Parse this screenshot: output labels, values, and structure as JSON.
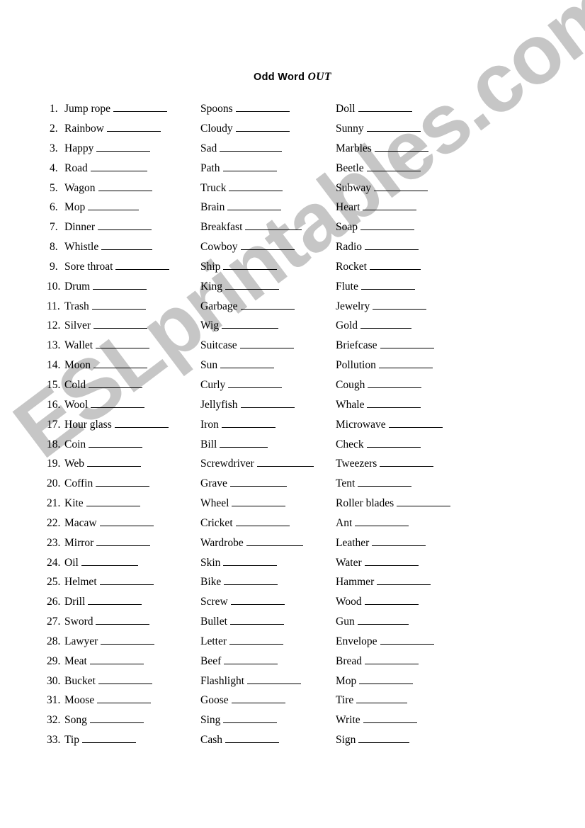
{
  "title": {
    "main": "Odd Word ",
    "emphasis": "OUT"
  },
  "watermark": {
    "text": "ESLprintables.com",
    "color": "#c6c6c6"
  },
  "columns": [
    {
      "name": "column-1",
      "numbered": true,
      "items": [
        {
          "number": "1.",
          "word": "Jump rope",
          "blank_width": 76
        },
        {
          "number": "2.",
          "word": "Rainbow",
          "blank_width": 76
        },
        {
          "number": "3.",
          "word": "Happy",
          "blank_width": 76
        },
        {
          "number": "4.",
          "word": "Road",
          "blank_width": 80
        },
        {
          "number": "5.",
          "word": "Wagon",
          "blank_width": 76
        },
        {
          "number": "6.",
          "word": "Mop",
          "blank_width": 72
        },
        {
          "number": "7.",
          "word": "Dinner",
          "blank_width": 76
        },
        {
          "number": "8.",
          "word": "Whistle",
          "blank_width": 72
        },
        {
          "number": "9.",
          "word": "Sore throat",
          "blank_width": 76
        },
        {
          "number": "10.",
          "word": "Drum",
          "blank_width": 76
        },
        {
          "number": "11.",
          "word": "Trash",
          "blank_width": 76
        },
        {
          "number": "12.",
          "word": "Silver",
          "blank_width": 76
        },
        {
          "number": "13.",
          "word": "Wallet",
          "blank_width": 76
        },
        {
          "number": "14.",
          "word": "Moon",
          "blank_width": 76
        },
        {
          "number": "15.",
          "word": "Cold",
          "blank_width": 76
        },
        {
          "number": "16.",
          "word": "Wool",
          "blank_width": 76
        },
        {
          "number": "17.",
          "word": "Hour glass",
          "blank_width": 76
        },
        {
          "number": "18.",
          "word": "Coin",
          "blank_width": 76
        },
        {
          "number": "19.",
          "word": "Web",
          "blank_width": 76
        },
        {
          "number": "20.",
          "word": "Coffin",
          "blank_width": 76
        },
        {
          "number": "21.",
          "word": "Kite",
          "blank_width": 76
        },
        {
          "number": "22.",
          "word": "Macaw",
          "blank_width": 76
        },
        {
          "number": "23.",
          "word": "Mirror",
          "blank_width": 76
        },
        {
          "number": "24.",
          "word": "Oil",
          "blank_width": 80
        },
        {
          "number": "25.",
          "word": "Helmet",
          "blank_width": 76
        },
        {
          "number": "26.",
          "word": "Drill",
          "blank_width": 76
        },
        {
          "number": "27.",
          "word": "Sword",
          "blank_width": 76
        },
        {
          "number": "28.",
          "word": "Lawyer",
          "blank_width": 76
        },
        {
          "number": "29.",
          "word": "Meat",
          "blank_width": 76
        },
        {
          "number": "30.",
          "word": "Bucket",
          "blank_width": 76
        },
        {
          "number": "31.",
          "word": "Moose",
          "blank_width": 76
        },
        {
          "number": "32.",
          "word": "Song",
          "blank_width": 76
        },
        {
          "number": "33.",
          "word": "Tip",
          "blank_width": 76
        }
      ]
    },
    {
      "name": "column-2",
      "numbered": false,
      "items": [
        {
          "word": "Spoons",
          "blank_width": 76
        },
        {
          "word": "Cloudy",
          "blank_width": 76
        },
        {
          "word": "Sad",
          "blank_width": 88
        },
        {
          "word": "Path",
          "blank_width": 76
        },
        {
          "word": "Truck",
          "blank_width": 76
        },
        {
          "word": "Brain",
          "blank_width": 76
        },
        {
          "word": "Breakfast",
          "blank_width": 80
        },
        {
          "word": "Cowboy",
          "blank_width": 76
        },
        {
          "word": "Ship",
          "blank_width": 76
        },
        {
          "word": "King",
          "blank_width": 76
        },
        {
          "word": "Garbage",
          "blank_width": 76
        },
        {
          "word": "Wig",
          "blank_width": 80
        },
        {
          "word": "Suitcase",
          "blank_width": 76
        },
        {
          "word": "Sun",
          "blank_width": 76
        },
        {
          "word": "Curly",
          "blank_width": 76
        },
        {
          "word": "Jellyfish",
          "blank_width": 76
        },
        {
          "word": "Iron",
          "blank_width": 76
        },
        {
          "word": "Bill",
          "blank_width": 68
        },
        {
          "word": "Screwdriver",
          "blank_width": 80
        },
        {
          "word": "Grave",
          "blank_width": 80
        },
        {
          "word": "Wheel",
          "blank_width": 76
        },
        {
          "word": "Cricket",
          "blank_width": 76
        },
        {
          "word": "Wardrobe",
          "blank_width": 80
        },
        {
          "word": "Skin",
          "blank_width": 76
        },
        {
          "word": "Bike",
          "blank_width": 76
        },
        {
          "word": "Screw",
          "blank_width": 76
        },
        {
          "word": "Bullet",
          "blank_width": 76
        },
        {
          "word": "Letter",
          "blank_width": 76
        },
        {
          "word": "Beef",
          "blank_width": 76
        },
        {
          "word": "Flashlight",
          "blank_width": 76
        },
        {
          "word": "Goose",
          "blank_width": 76
        },
        {
          "word": "Sing",
          "blank_width": 76
        },
        {
          "word": "Cash",
          "blank_width": 76
        }
      ]
    },
    {
      "name": "column-3",
      "numbered": false,
      "items": [
        {
          "word": "Doll",
          "blank_width": 76
        },
        {
          "word": "Sunny",
          "blank_width": 76
        },
        {
          "word": "Marbles",
          "blank_width": 76
        },
        {
          "word": "Beetle",
          "blank_width": 76
        },
        {
          "word": "Subway",
          "blank_width": 76
        },
        {
          "word": "Heart",
          "blank_width": 76
        },
        {
          "word": "Soap",
          "blank_width": 76
        },
        {
          "word": "Radio",
          "blank_width": 76
        },
        {
          "word": "Rocket",
          "blank_width": 72
        },
        {
          "word": "Flute",
          "blank_width": 76
        },
        {
          "word": "Jewelry",
          "blank_width": 76
        },
        {
          "word": "Gold",
          "blank_width": 72
        },
        {
          "word": "Briefcase",
          "blank_width": 76
        },
        {
          "word": "Pollution",
          "blank_width": 76
        },
        {
          "word": "Cough",
          "blank_width": 76
        },
        {
          "word": "Whale",
          "blank_width": 76
        },
        {
          "word": "Microwave",
          "blank_width": 76
        },
        {
          "word": "Check",
          "blank_width": 76
        },
        {
          "word": "Tweezers",
          "blank_width": 76
        },
        {
          "word": "Tent",
          "blank_width": 76
        },
        {
          "word": "Roller blades",
          "blank_width": 76
        },
        {
          "word": "Ant",
          "blank_width": 76
        },
        {
          "word": "Leather",
          "blank_width": 76
        },
        {
          "word": "Water",
          "blank_width": 76
        },
        {
          "word": "Hammer",
          "blank_width": 76
        },
        {
          "word": "Wood",
          "blank_width": 76
        },
        {
          "word": "Gun",
          "blank_width": 72
        },
        {
          "word": "Envelope",
          "blank_width": 76
        },
        {
          "word": "Bread",
          "blank_width": 76
        },
        {
          "word": "Mop",
          "blank_width": 76
        },
        {
          "word": "Tire",
          "blank_width": 72
        },
        {
          "word": "Write",
          "blank_width": 76
        },
        {
          "word": "Sign",
          "blank_width": 72
        }
      ]
    }
  ]
}
